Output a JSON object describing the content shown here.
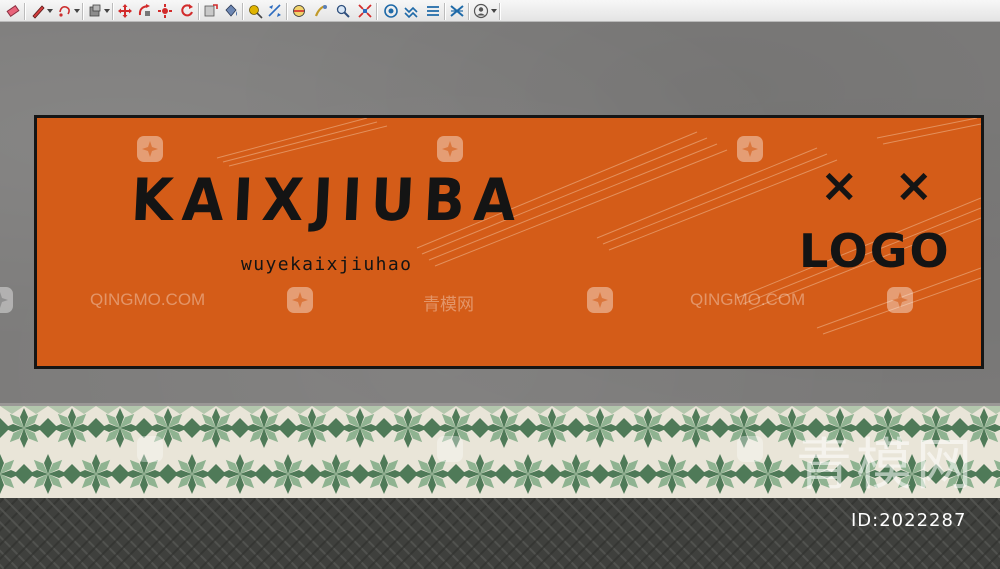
{
  "toolbar": {
    "tools": [
      {
        "name": "eraser-icon"
      },
      {
        "name": "pencil-icon"
      },
      {
        "name": "polygon-icon"
      },
      {
        "name": "push-pull-icon"
      },
      {
        "name": "move-icon"
      },
      {
        "name": "orbit-icon"
      },
      {
        "name": "rotate-icon"
      },
      {
        "name": "offset-icon"
      },
      {
        "name": "follow-me-icon"
      },
      {
        "name": "paint-bucket-icon"
      },
      {
        "name": "tape-measure-icon"
      },
      {
        "name": "dimension-icon"
      },
      {
        "name": "section-plane-icon"
      },
      {
        "name": "zoom-icon"
      },
      {
        "name": "zoom-extents-icon"
      },
      {
        "name": "walk-icon"
      },
      {
        "name": "look-around-icon"
      },
      {
        "name": "layers-icon"
      },
      {
        "name": "components-icon"
      },
      {
        "name": "user-icon"
      }
    ]
  },
  "sign": {
    "brand_name": "KAIXJIUBA",
    "subtitle": "wuyekaixjiuhao",
    "logo_marks": "× ×",
    "logo_word": "LOGO",
    "background_color": "#d45c18",
    "text_color": "#141414"
  },
  "watermarks": {
    "text_latin": "QINGMO.COM",
    "text_cn": "青模网",
    "big_cn": "青模网",
    "image_id": "ID:2022287"
  },
  "colors": {
    "wall": "#7d7c7b",
    "tile_green": "#4f7a58",
    "tile_light_green": "#8fb391",
    "tile_cream": "#e9e5d8",
    "floor": "#3f403d"
  }
}
